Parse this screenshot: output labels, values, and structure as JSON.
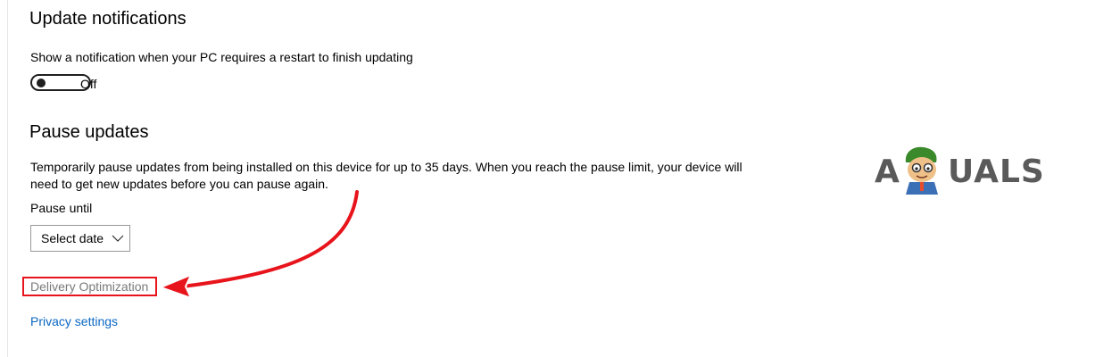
{
  "update_notifications": {
    "heading": "Update notifications",
    "description": "Show a notification when your PC requires a restart to finish updating",
    "toggle_state": "Off",
    "toggle_on": false
  },
  "pause_updates": {
    "heading": "Pause updates",
    "description_line1": "Temporarily pause updates from being installed on this device for up to 35 days. When you reach the pause limit, your device will",
    "description_line2": "need to get new updates before you can pause again.",
    "pause_until_label": "Pause until",
    "select_value": "Select date"
  },
  "links": {
    "delivery_optimization": "Delivery Optimization",
    "privacy_settings": "Privacy settings"
  },
  "watermark": {
    "text": "APPUALS"
  },
  "colors": {
    "annotation_red": "#e8141b",
    "link_blue": "#0a67c3",
    "disabled_gray": "#7a7a7a"
  }
}
